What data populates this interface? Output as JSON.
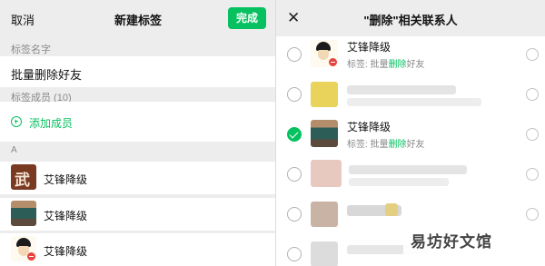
{
  "left": {
    "cancel_label": "取消",
    "title": "新建标签",
    "done_label": "完成",
    "tag_name_label": "标签名字",
    "tag_name_value": "批量删除好友",
    "members_label": "标签成员 (10)",
    "add_member_label": "添加成员",
    "index_letter": "A",
    "members": [
      {
        "name": "艾锋降级",
        "avatar": "brown-avatar"
      },
      {
        "name": "艾锋降级",
        "avatar": "laptop-avatar"
      },
      {
        "name": "艾锋降级",
        "avatar": "cartoon-avatar"
      }
    ]
  },
  "right": {
    "title": "\"删除\"相关联系人",
    "contacts": [
      {
        "name": "艾锋降级",
        "sub_prefix": "标签: 批量",
        "sub_highlight": "删除",
        "sub_suffix": "好友",
        "checked": false
      },
      {
        "name": "",
        "blurred": true,
        "checked": false
      },
      {
        "name": "艾锋降级",
        "sub_prefix": "标签: 批量",
        "sub_highlight": "删除",
        "sub_suffix": "好友",
        "checked": true
      },
      {
        "name": "",
        "blurred": true,
        "checked": false
      },
      {
        "name": "",
        "blurred": true,
        "checked": false
      },
      {
        "name": "",
        "blurred": true,
        "checked": false
      }
    ]
  },
  "watermark": "易坊好文馆",
  "colors": {
    "accent": "#07c160",
    "danger": "#e64340",
    "background": "#ededed"
  }
}
